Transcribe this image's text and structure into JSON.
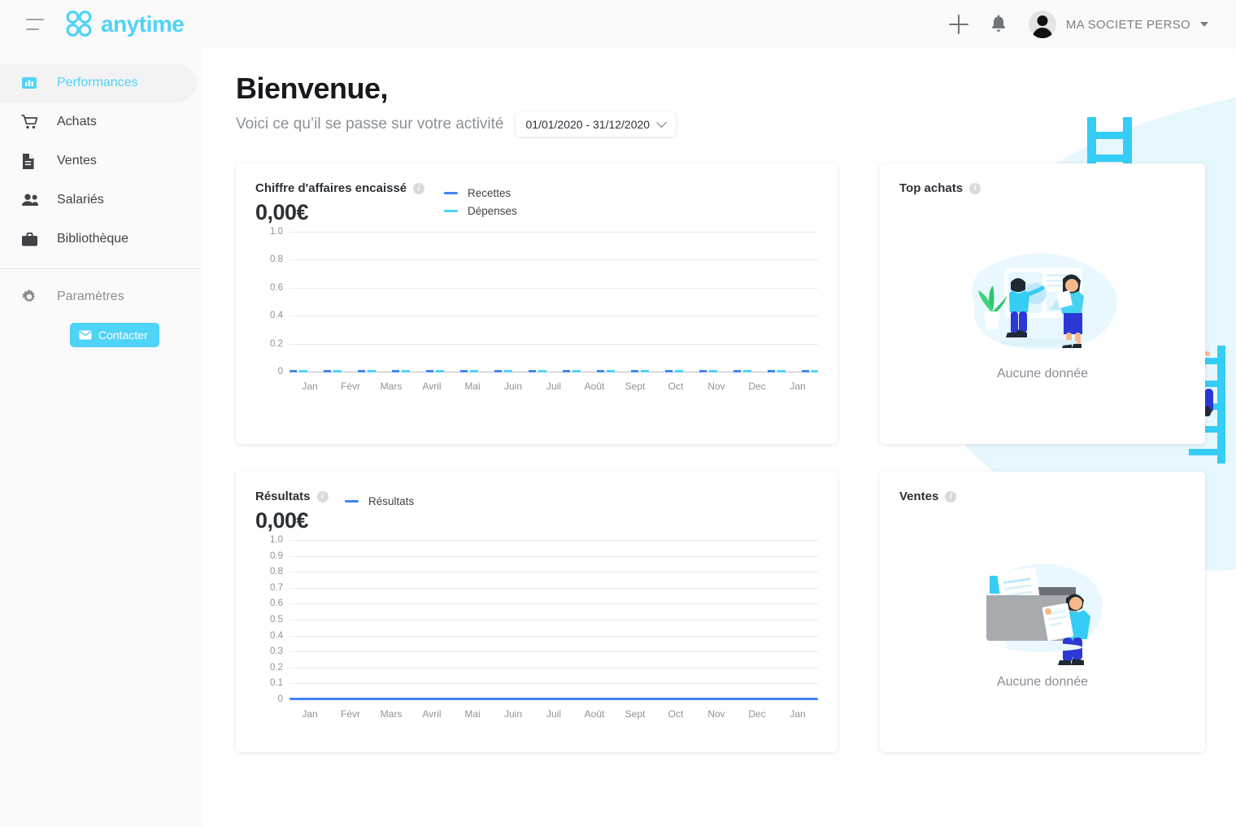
{
  "topbar": {
    "menu_icon": "hamburger-icon",
    "brand": "anytime",
    "add_icon": "plus-icon",
    "notifications_icon": "bell-icon",
    "avatar_icon": "user-avatar-icon",
    "account_name": "MA SOCIETE PERSO",
    "caret_icon": "chevron-down-icon"
  },
  "sidebar": {
    "items": [
      {
        "label": "Performances",
        "icon": "chart-bar-icon",
        "active": true
      },
      {
        "label": "Achats",
        "icon": "shopping-cart-icon",
        "active": false
      },
      {
        "label": "Ventes",
        "icon": "document-icon",
        "active": false
      },
      {
        "label": "Salariés",
        "icon": "people-icon",
        "active": false
      },
      {
        "label": "Bibliothèque",
        "icon": "briefcase-icon",
        "active": false
      }
    ],
    "settings": {
      "label": "Paramètres",
      "icon": "gear-icon"
    },
    "contact_button": {
      "label": "Contacter",
      "icon": "envelope-icon"
    }
  },
  "header": {
    "title": "Bienvenue,",
    "subtitle": "Voici ce qu’il se passe sur votre activité",
    "date_range": "01/01/2020 - 31/12/2020",
    "date_caret_icon": "chevron-down-icon"
  },
  "colors": {
    "accent": "#4fd3f7",
    "recettes": "#4285f4",
    "depenses": "#4fd3f7",
    "resultats": "#4285f4",
    "text_dark": "#2c3034",
    "text_muted": "#8a8f95"
  },
  "cards": {
    "revenue": {
      "title": "Chiffre d'affaires encaissé",
      "info_icon": "info-icon",
      "amount": "0,00€",
      "legend": [
        {
          "label": "Recettes",
          "color": "#4285f4"
        },
        {
          "label": "Dépenses",
          "color": "#4fd3f7"
        }
      ]
    },
    "results": {
      "title": "Résultats",
      "info_icon": "info-icon",
      "amount": "0,00€",
      "legend": [
        {
          "label": "Résultats",
          "color": "#4285f4"
        }
      ]
    },
    "top_achats": {
      "title": "Top achats",
      "info_icon": "info-icon",
      "empty_text": "Aucune donnée",
      "illustration": "people-presentation-illustration"
    },
    "ventes": {
      "title": "Ventes",
      "info_icon": "info-icon",
      "empty_text": "Aucune donnée",
      "illustration": "folder-documents-illustration"
    }
  },
  "chart_data": [
    {
      "type": "line",
      "title": "Chiffre d'affaires encaissé",
      "xlabel": "",
      "ylabel": "",
      "categories": [
        "Jan",
        "Févr",
        "Mars",
        "Avril",
        "Mai",
        "Juin",
        "Juil",
        "Août",
        "Sept",
        "Oct",
        "Nov",
        "Dec",
        "Jan"
      ],
      "yticks": [
        0,
        0.2,
        0.4,
        0.6,
        0.8,
        1.0
      ],
      "ylim": [
        0,
        1.0
      ],
      "grid": true,
      "legend_position": "top-right",
      "series": [
        {
          "name": "Recettes",
          "color": "#4285f4",
          "values": [
            0,
            0,
            0,
            0,
            0,
            0,
            0,
            0,
            0,
            0,
            0,
            0,
            0
          ]
        },
        {
          "name": "Dépenses",
          "color": "#4fd3f7",
          "values": [
            0,
            0,
            0,
            0,
            0,
            0,
            0,
            0,
            0,
            0,
            0,
            0,
            0
          ]
        }
      ]
    },
    {
      "type": "line",
      "title": "Résultats",
      "xlabel": "",
      "ylabel": "",
      "categories": [
        "Jan",
        "Févr",
        "Mars",
        "Avril",
        "Mai",
        "Juin",
        "Juil",
        "Août",
        "Sept",
        "Oct",
        "Nov",
        "Dec",
        "Jan"
      ],
      "yticks": [
        0,
        0.1,
        0.2,
        0.3,
        0.4,
        0.5,
        0.6,
        0.7,
        0.8,
        0.9,
        1.0
      ],
      "ylim": [
        0,
        1.0
      ],
      "grid": true,
      "legend_position": "top-right",
      "series": [
        {
          "name": "Résultats",
          "color": "#4285f4",
          "values": [
            0,
            0,
            0,
            0,
            0,
            0,
            0,
            0,
            0,
            0,
            0,
            0,
            0
          ]
        }
      ]
    }
  ]
}
